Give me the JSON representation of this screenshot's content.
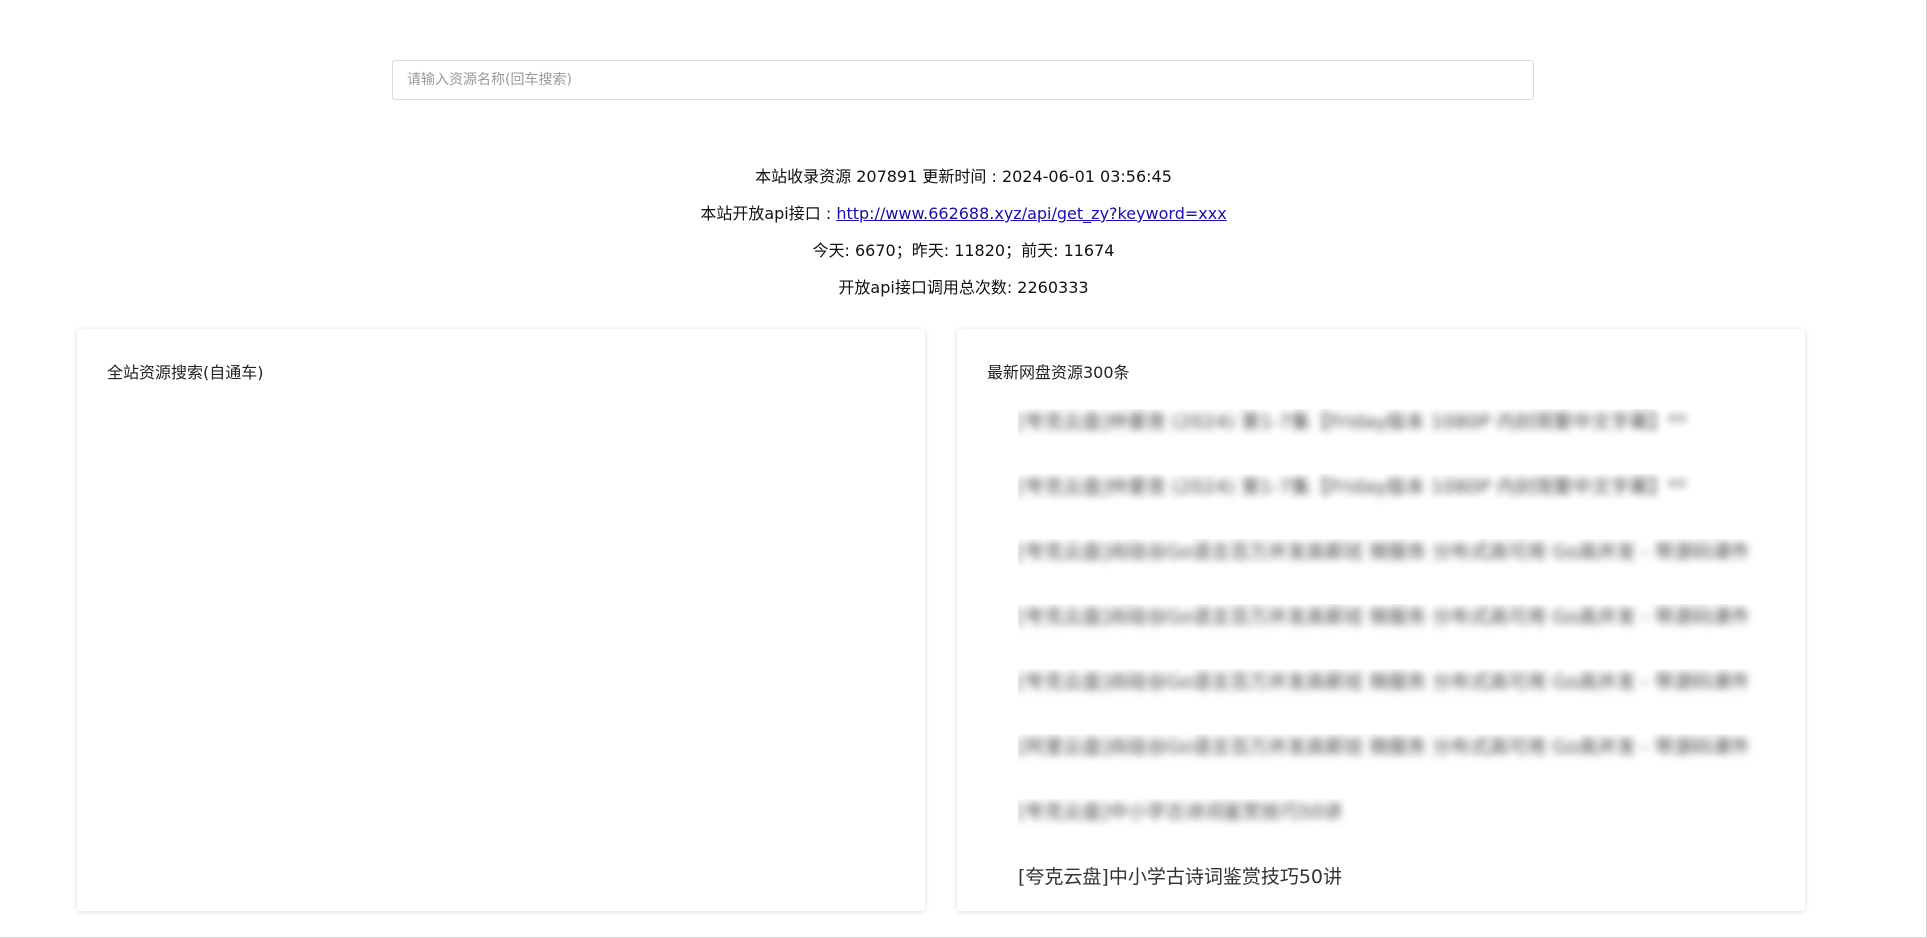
{
  "search": {
    "placeholder": "请输入资源名称(回车搜索)"
  },
  "info": {
    "line1": "本站收录资源 207891 更新时间 : 2024-06-01 03:56:45",
    "api_prefix": "本站开放api接口 : ",
    "api_url": "http://www.662688.xyz/api/get_zy?keyword=xxx",
    "stats": "今天: 6670；昨天: 11820；前天: 11674",
    "api_total": "开放api接口调用总次数: 2260333"
  },
  "left_card": {
    "title": "全站资源搜索(自通车)"
  },
  "right_card": {
    "title": "最新网盘资源300条",
    "items": [
      {
        "text": "[夸克云盘]仲夏夜 (2024) 第1-7集【Friday版本 1080P 内封简繁中文字幕】**",
        "blurred": true
      },
      {
        "text": "[夸克云盘]仲夏夜 (2024) 第1-7集【Friday版本 1080P 内封简繁中文字幕】**",
        "blurred": true
      },
      {
        "text": "[夸克云盘]尚硅谷Go语言百万并发高薪班 微服务 分布式高可用 Go高并发 - 带源码课件",
        "blurred": true
      },
      {
        "text": "[夸克云盘]尚硅谷Go语言百万并发高薪班 微服务 分布式高可用 Go高并发 - 带源码课件",
        "blurred": true
      },
      {
        "text": "[夸克云盘]尚硅谷Go语言百万并发高薪班 微服务 分布式高可用 Go高并发 - 带源码课件",
        "blurred": true
      },
      {
        "text": "[阿里云盘]尚硅谷Go语言百万并发高薪班 微服务 分布式高可用 Go高并发 - 带源码课件",
        "blurred": true
      },
      {
        "text": "[夸克云盘]中小学古诗词鉴赏技巧50讲",
        "blurred": true
      },
      {
        "text": "[夸克云盘]中小学古诗词鉴赏技巧50讲",
        "blurred": false
      }
    ]
  }
}
